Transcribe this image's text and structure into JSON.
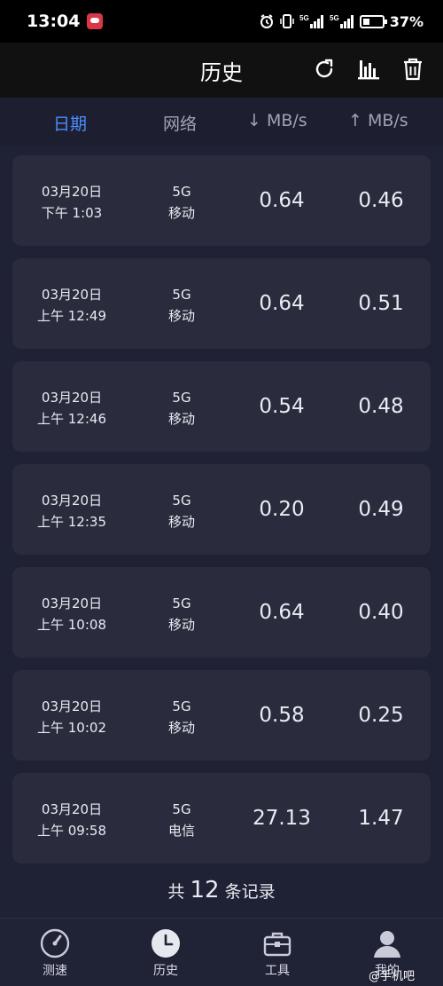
{
  "status_bar": {
    "time": "13:04",
    "battery": "37%",
    "battery_level": 0.37,
    "network": "5G"
  },
  "app_bar": {
    "title": "历史",
    "actions": [
      "refresh-icon",
      "bar-chart-icon",
      "trash-icon"
    ]
  },
  "columns": {
    "date": "日期",
    "network": "网络",
    "download": "↓ MB/s",
    "upload": "↑ MB/s"
  },
  "records": [
    {
      "date": "03月20日",
      "time": "下午 1:03",
      "network_type": "5G",
      "carrier": "移动",
      "download": "0.64",
      "upload": "0.46"
    },
    {
      "date": "03月20日",
      "time": "上午 12:49",
      "network_type": "5G",
      "carrier": "移动",
      "download": "0.64",
      "upload": "0.51"
    },
    {
      "date": "03月20日",
      "time": "上午 12:46",
      "network_type": "5G",
      "carrier": "移动",
      "download": "0.54",
      "upload": "0.48"
    },
    {
      "date": "03月20日",
      "time": "上午 12:35",
      "network_type": "5G",
      "carrier": "移动",
      "download": "0.20",
      "upload": "0.49"
    },
    {
      "date": "03月20日",
      "time": "上午 10:08",
      "network_type": "5G",
      "carrier": "移动",
      "download": "0.64",
      "upload": "0.40"
    },
    {
      "date": "03月20日",
      "time": "上午 10:02",
      "network_type": "5G",
      "carrier": "移动",
      "download": "0.58",
      "upload": "0.25"
    },
    {
      "date": "03月20日",
      "time": "上午 09:58",
      "network_type": "5G",
      "carrier": "电信",
      "download": "27.13",
      "upload": "1.47"
    }
  ],
  "footer": {
    "prefix": "共",
    "count": "12",
    "suffix": "条记录"
  },
  "bottom_nav": [
    {
      "label": "测速",
      "icon": "speedometer-icon"
    },
    {
      "label": "历史",
      "icon": "clock-icon",
      "active": true
    },
    {
      "label": "工具",
      "icon": "toolbox-icon"
    },
    {
      "label": "我的",
      "icon": "profile-icon"
    }
  ],
  "watermark": "@手机吧",
  "colors": {
    "accent": "#4a8eff",
    "background": "#1f2134",
    "card": "#2a2b3c"
  }
}
